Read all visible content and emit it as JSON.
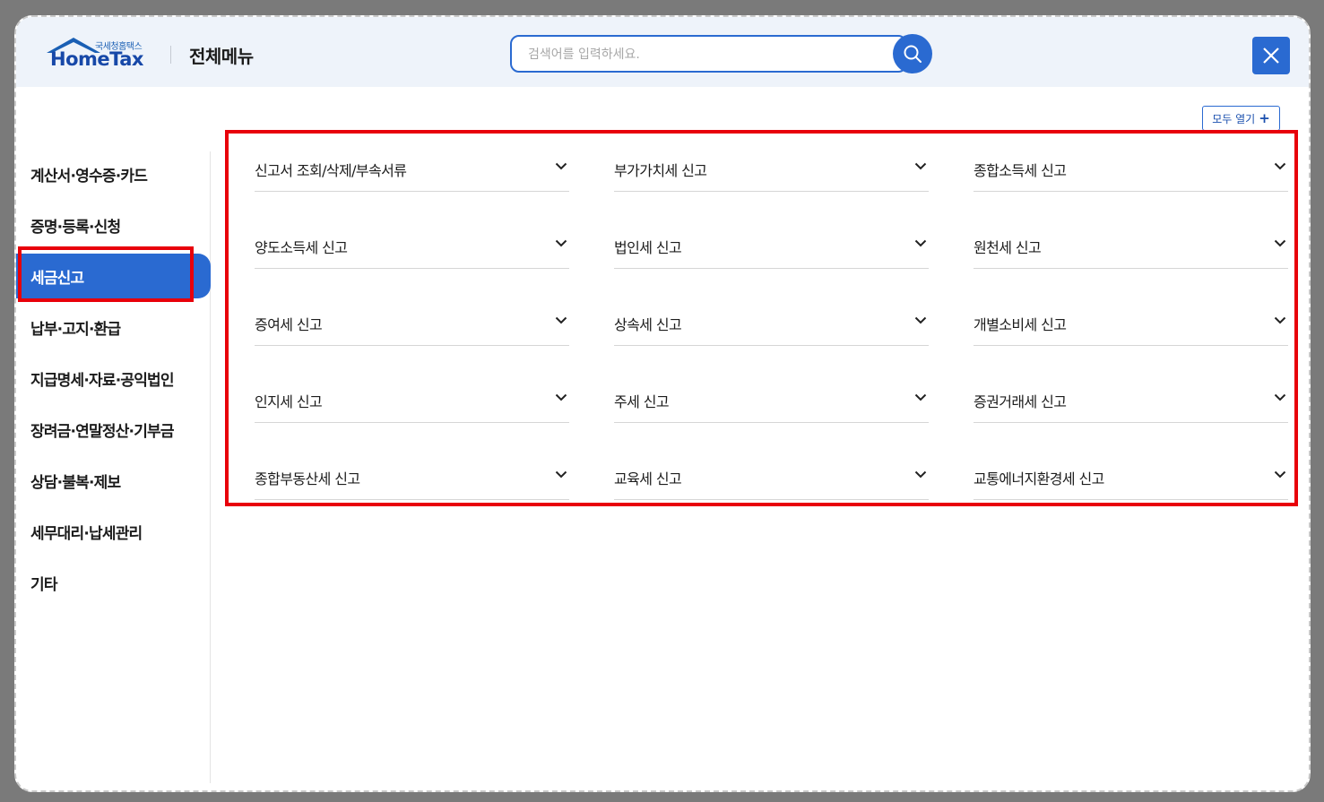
{
  "header": {
    "logo_sub": "국세청홈택스",
    "logo_text": "HomeTax",
    "title": "전체메뉴",
    "search_placeholder": "검색어를 입력하세요.",
    "search_icon": "search-icon",
    "close_icon": "close-icon"
  },
  "toolbar": {
    "open_all_label": "모두 열기",
    "open_all_icon": "plus-icon"
  },
  "sidebar": {
    "items": [
      {
        "label": "계산서·영수증·카드",
        "active": false
      },
      {
        "label": "증명·등록·신청",
        "active": false
      },
      {
        "label": "세금신고",
        "active": true
      },
      {
        "label": "납부·고지·환급",
        "active": false
      },
      {
        "label": "지급명세·자료·공익법인",
        "active": false
      },
      {
        "label": "장려금·연말정산·기부금",
        "active": false
      },
      {
        "label": "상담·불복·제보",
        "active": false
      },
      {
        "label": "세무대리·납세관리",
        "active": false
      },
      {
        "label": "기타",
        "active": false
      }
    ]
  },
  "main": {
    "items": [
      {
        "label": "신고서 조회/삭제/부속서류",
        "icon": "chevron-down-icon"
      },
      {
        "label": "부가가치세 신고",
        "icon": "chevron-down-icon"
      },
      {
        "label": "종합소득세 신고",
        "icon": "chevron-down-icon"
      },
      {
        "label": "양도소득세 신고",
        "icon": "chevron-down-icon"
      },
      {
        "label": "법인세 신고",
        "icon": "chevron-down-icon"
      },
      {
        "label": "원천세 신고",
        "icon": "chevron-down-icon"
      },
      {
        "label": "증여세 신고",
        "icon": "chevron-down-icon"
      },
      {
        "label": "상속세 신고",
        "icon": "chevron-down-icon"
      },
      {
        "label": "개별소비세 신고",
        "icon": "chevron-down-icon"
      },
      {
        "label": "인지세 신고",
        "icon": "chevron-down-icon"
      },
      {
        "label": "주세 신고",
        "icon": "chevron-down-icon"
      },
      {
        "label": "증권거래세 신고",
        "icon": "chevron-down-icon"
      },
      {
        "label": "종합부동산세 신고",
        "icon": "chevron-down-icon"
      },
      {
        "label": "교육세 신고",
        "icon": "chevron-down-icon"
      },
      {
        "label": "교통에너지환경세 신고",
        "icon": "chevron-down-icon"
      }
    ]
  },
  "colors": {
    "accent": "#2a6ad1",
    "highlight": "#e8000a",
    "header_bg": "#eef3fa"
  }
}
